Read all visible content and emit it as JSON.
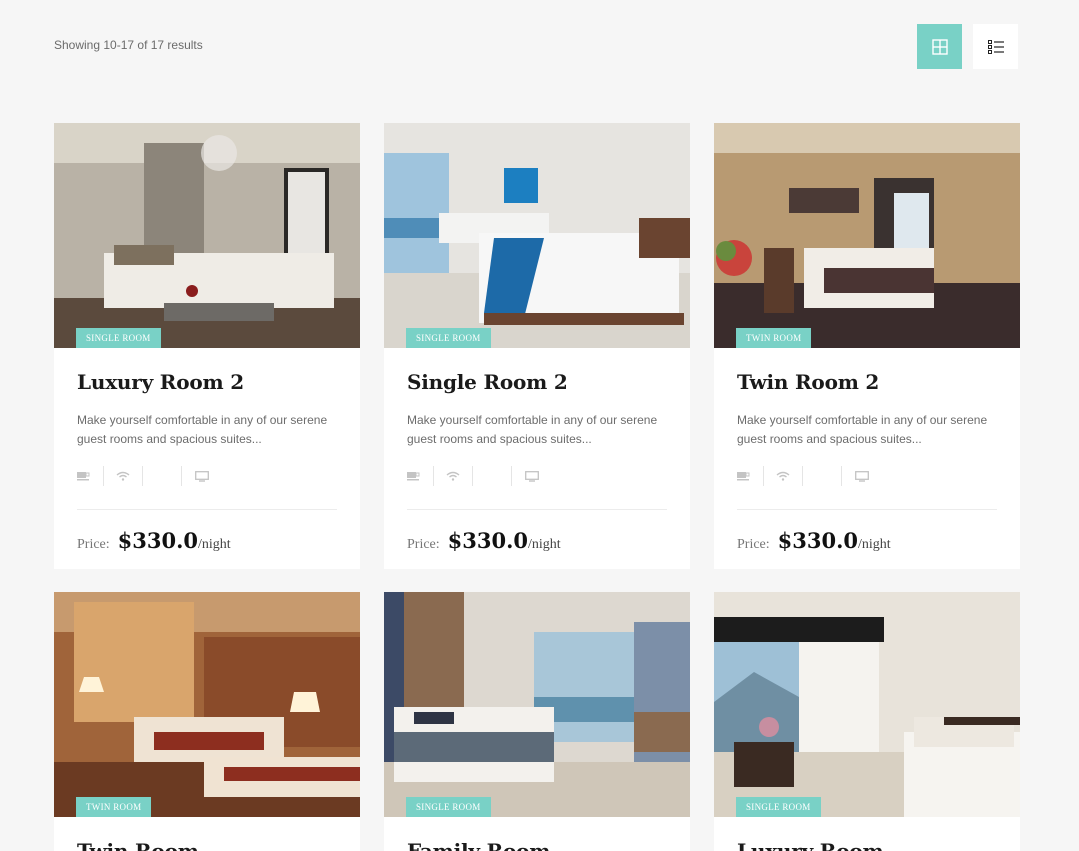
{
  "results": {
    "text": "Showing 10-17 of 17 results"
  },
  "view": {
    "grid_icon": "grid-view-icon",
    "list_icon": "list-view-icon",
    "active_color": "#79d1c6"
  },
  "amenity_icons": [
    "coffee-icon",
    "wifi-icon",
    "blank-icon",
    "tv-icon"
  ],
  "price_label": "Price:",
  "price_unit": "/night",
  "rooms": [
    {
      "badge": "SINGLE ROOM",
      "title": "Luxury Room 2",
      "desc": "Make yourself comfortable in any of our serene guest rooms and spacious suites...",
      "price": "$330.0"
    },
    {
      "badge": "SINGLE ROOM",
      "title": "Single Room 2",
      "desc": "Make yourself comfortable in any of our serene guest rooms and spacious suites...",
      "price": "$330.0"
    },
    {
      "badge": "TWIN ROOM",
      "title": "Twin Room 2",
      "desc": "Make yourself comfortable in any of our serene guest rooms and spacious suites...",
      "price": "$330.0"
    },
    {
      "badge": "TWIN ROOM",
      "title": "Twin Room",
      "desc": "",
      "price": ""
    },
    {
      "badge": "SINGLE ROOM",
      "title": "Family Room",
      "desc": "",
      "price": ""
    },
    {
      "badge": "SINGLE ROOM",
      "title": "Luxury Room",
      "desc": "",
      "price": ""
    }
  ]
}
